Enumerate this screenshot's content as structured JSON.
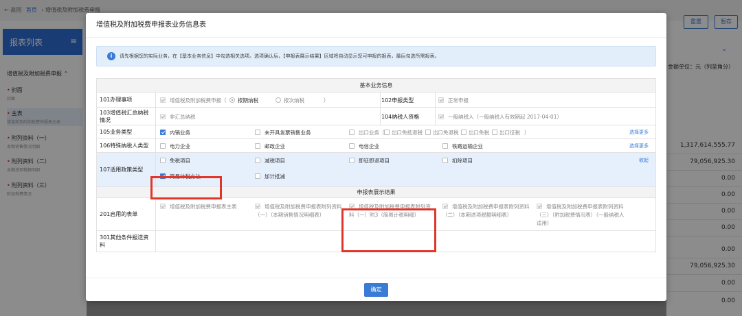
{
  "background": {
    "breadcrumb": {
      "back": "← 返回",
      "home": "首页",
      "sep": "›",
      "current": "增值税及附加税费申报"
    },
    "sidebar": {
      "title": "报表列表",
      "group": "增值税及附加税费申报",
      "items": [
        {
          "label": "封面",
          "sub": "封面"
        },
        {
          "label": "主表",
          "sub": "增值税及附加税费申报表主表"
        },
        {
          "label": "附列资料（一）",
          "sub": "本期销售情况明细"
        },
        {
          "label": "附列资料（二）",
          "sub": "本期进项税额明细"
        },
        {
          "label": "附列资料（三）",
          "sub": "附加税费情况"
        }
      ]
    },
    "buttons": [
      "重置",
      "暂存"
    ],
    "unit": "金额单位：元（列至角分）",
    "numbers": [
      "1,317,614,555.77",
      "79,056,925.30",
      "0.00",
      "0.00",
      "0.00",
      "0.00",
      "0.00",
      "79,056,925.30",
      "0.00",
      "0.00"
    ]
  },
  "modal": {
    "title": "增值税及附加税费申报表业务信息表",
    "notice": "请先根据您的实际业务，在【基本业务信息】中勾选相关选项。选项确认后，【申报表展示结果】区域将自动显示您可申报的报表，最后勾选所需报表。",
    "section_basic": "基本业务信息",
    "section_result": "申报表展示结果",
    "row101": {
      "label": "101办理事项",
      "item": "增值税及附加税费申报（",
      "opt1": "按期纳税",
      "opt2": "按次纳税",
      "close": "）"
    },
    "row102": {
      "label": "102申报类型",
      "item": "正常申报"
    },
    "row103": {
      "label": "103增值税汇总纳税情况",
      "item": "非汇总纳税"
    },
    "row104": {
      "label": "104纳税人资格",
      "item": "一般纳税人（一般纳税人有效期起 2017-04-01）"
    },
    "row105": {
      "label": "105业务类型",
      "items": [
        "内销业务",
        "未开具发票销售业务",
        "出口业务（",
        "出口免抵退税",
        "出口免退税",
        "出口免税",
        "出口征税",
        "）"
      ],
      "more": "选择更多"
    },
    "row106": {
      "label": "106特殊纳税人类型",
      "items": [
        "电力企业",
        "邮政企业",
        "电信企业",
        "铁路运输企业"
      ],
      "more": "选择更多"
    },
    "row107": {
      "label": "107适用政策类型",
      "items": [
        "免税项目",
        "减税项目",
        "即征即退项目",
        "扣除项目",
        "简易计税方法",
        "加计抵减"
      ],
      "collapse": "收起"
    },
    "row201": {
      "label": "201启用的表单",
      "items": [
        "增值税及附加税费申报表主表",
        "增值税及附加税费申报表附列资料（一）（本期销售情况明细表）",
        "增值税及附加税费申报表附列资料（一）附3（简易计税明细）",
        "增值税及附加税费申报表附列资料（二）（本期进项税额明细表）",
        "增值税及附加税费申报表附列资料（三）（附加税费情况表）（一般纳税人适用）"
      ]
    },
    "row301": {
      "label": "301其他条件报送资料"
    },
    "confirm": "确定"
  },
  "colors": {
    "accent": "#3a7bd5",
    "highlight": "#e0362a",
    "blue_row": "#e6effc"
  }
}
